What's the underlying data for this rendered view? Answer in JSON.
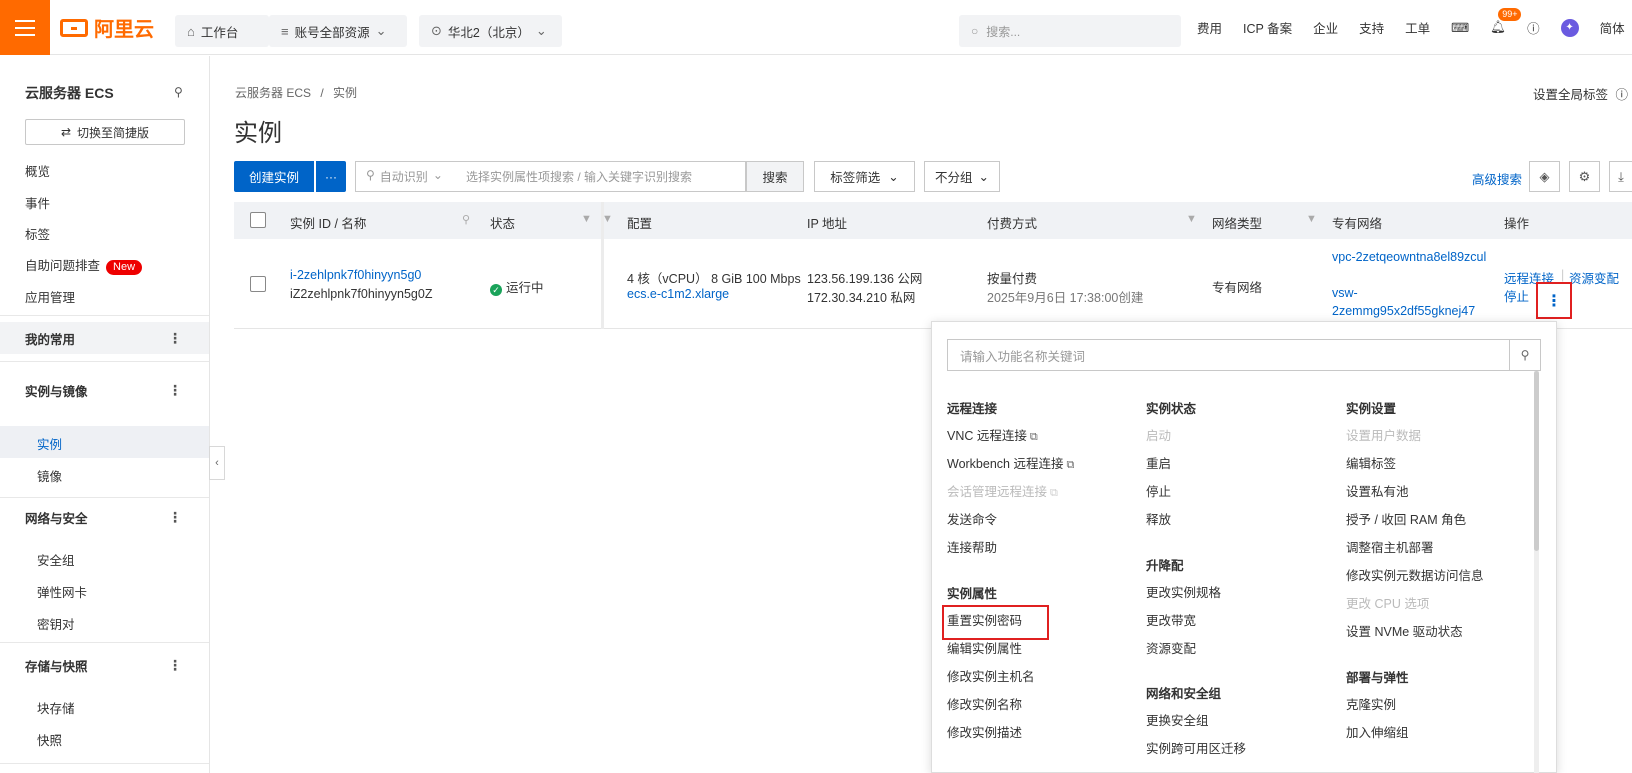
{
  "topbar": {
    "logo_text": "阿里云",
    "workbench": "工作台",
    "account_scope": "账号全部资源",
    "region": "华北2（北京）",
    "search_placeholder": "搜索...",
    "links": [
      "费用",
      "ICP 备案",
      "企业",
      "支持",
      "工单"
    ],
    "notification_count": "99+",
    "language": "简体"
  },
  "sidebar": {
    "title": "云服务器 ECS",
    "switch_label": "切换至简捷版",
    "items": [
      "概览",
      "事件",
      "标签",
      "自助问题排查",
      "应用管理"
    ],
    "new_badge": "New",
    "favorites": "我的常用",
    "group_instances": "实例与镜像",
    "sub_instances": [
      "实例",
      "镜像"
    ],
    "group_network": "网络与安全",
    "sub_network": [
      "安全组",
      "弹性网卡",
      "密钥对"
    ],
    "group_storage": "存储与快照",
    "sub_storage": [
      "块存储",
      "快照"
    ]
  },
  "main": {
    "breadcrumb_root": "云服务器 ECS",
    "breadcrumb_sep": "/",
    "breadcrumb_current": "实例",
    "title": "实例",
    "global_tag": "设置全局标签",
    "create_button": "创建实例",
    "more_button": "···",
    "filter_mode": "自动识别",
    "filter_placeholder": "选择实例属性项搜索 / 输入关键字识别搜索",
    "search_button": "搜索",
    "tag_filter": "标签筛选",
    "group_select": "不分组",
    "advanced_search": "高级搜索"
  },
  "table": {
    "columns": [
      "实例 ID / 名称",
      "状态",
      "配置",
      "IP 地址",
      "付费方式",
      "网络类型",
      "专有网络",
      "操作"
    ],
    "row": {
      "instance_id": "i-2zehlpnk7f0hinyyn5g0",
      "instance_name": "iZ2zehlpnk7f0hinyyn5g0Z",
      "status": "运行中",
      "config_cores": "4 核（vCPU）",
      "config_mem": "8 GiB",
      "config_bw": "100 Mbps",
      "instance_type": "ecs.e-c1m2.xlarge",
      "ip_public": "123.56.199.136 公网",
      "ip_private": "172.30.34.210 私网",
      "billing": "按量付费",
      "created": "2025年9月6日 17:38:00创建",
      "network_type": "专有网络",
      "vpc": "vpc-2zetqeowntna8el89zcul",
      "vsw_prefix": "vsw-",
      "vsw": "2zemmg95x2df55gknej47",
      "action_remote": "远程连接",
      "action_change": "资源变配",
      "action_stop": "停止"
    }
  },
  "panel": {
    "search_placeholder": "请输入功能名称关键词",
    "col1": {
      "h1": "远程连接",
      "items1": [
        "VNC 远程连接",
        "Workbench 远程连接",
        "会话管理远程连接",
        "发送命令",
        "连接帮助"
      ],
      "h2": "实例属性",
      "items2": [
        "重置实例密码",
        "编辑实例属性",
        "修改实例主机名",
        "修改实例名称",
        "修改实例描述"
      ]
    },
    "col2": {
      "h1": "实例状态",
      "items1": [
        "启动",
        "重启",
        "停止",
        "释放"
      ],
      "h2": "升降配",
      "items2": [
        "更改实例规格",
        "更改带宽",
        "资源变配"
      ],
      "h3": "网络和安全组",
      "items3": [
        "更换安全组",
        "实例跨可用区迁移"
      ]
    },
    "col3": {
      "h1": "实例设置",
      "items1": [
        "设置用户数据",
        "编辑标签",
        "设置私有池",
        "授予 / 收回 RAM 角色",
        "调整宿主机部署",
        "修改实例元数据访问信息",
        "更改 CPU 选项",
        "设置 NVMe 驱动状态"
      ],
      "h2": "部署与弹性",
      "items2": [
        "克隆实例",
        "加入伸缩组"
      ]
    }
  }
}
